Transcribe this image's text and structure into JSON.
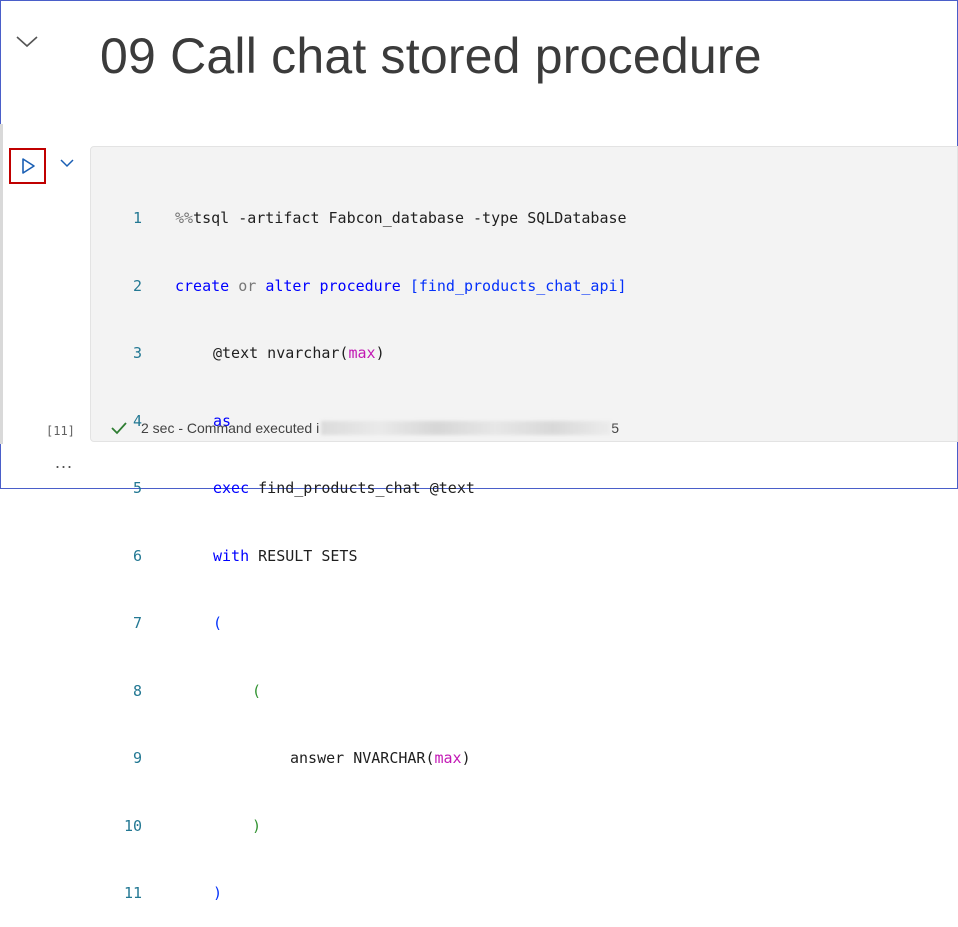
{
  "markdown_cell": {
    "title": "09 Call chat stored procedure"
  },
  "code_cell": {
    "execution_count": "[11]",
    "status_text": "2 sec - Command executed i",
    "status_tail": "5",
    "lines": [
      {
        "n": "1"
      },
      {
        "n": "2"
      },
      {
        "n": "3"
      },
      {
        "n": "4"
      },
      {
        "n": "5"
      },
      {
        "n": "6"
      },
      {
        "n": "7"
      },
      {
        "n": "8"
      },
      {
        "n": "9"
      },
      {
        "n": "10"
      },
      {
        "n": "11"
      }
    ],
    "code": {
      "l1_magic": "%%",
      "l1_rest": "tsql -artifact Fabcon_database -type SQLDatabase",
      "l2_create": "create",
      "l2_or": "or",
      "l2_alter": "alter",
      "l2_procedure": "procedure",
      "l2_name": "[find_products_chat_api]",
      "l3_param": "@text nvarchar(",
      "l3_max": "max",
      "l3_close": ")",
      "l4_as": "as",
      "l5_exec": "exec",
      "l5_rest": " find_products_chat @text",
      "l6_with": "with",
      "l6_rest": " RESULT SETS",
      "l7_open": "(",
      "l8_open": "(",
      "l9_col": "answer NVARCHAR(",
      "l9_max": "max",
      "l9_close": ")",
      "l10_close": ")",
      "l11_close": ")"
    }
  },
  "more_label": "...",
  "colors": {
    "keyword": "#0000ff",
    "function": "#c218b4",
    "run_highlight": "#c00000",
    "line_number": "#237893",
    "success": "#2e7d32"
  },
  "icons": [
    "chevron-down-icon",
    "run-icon",
    "checkmark-icon"
  ]
}
